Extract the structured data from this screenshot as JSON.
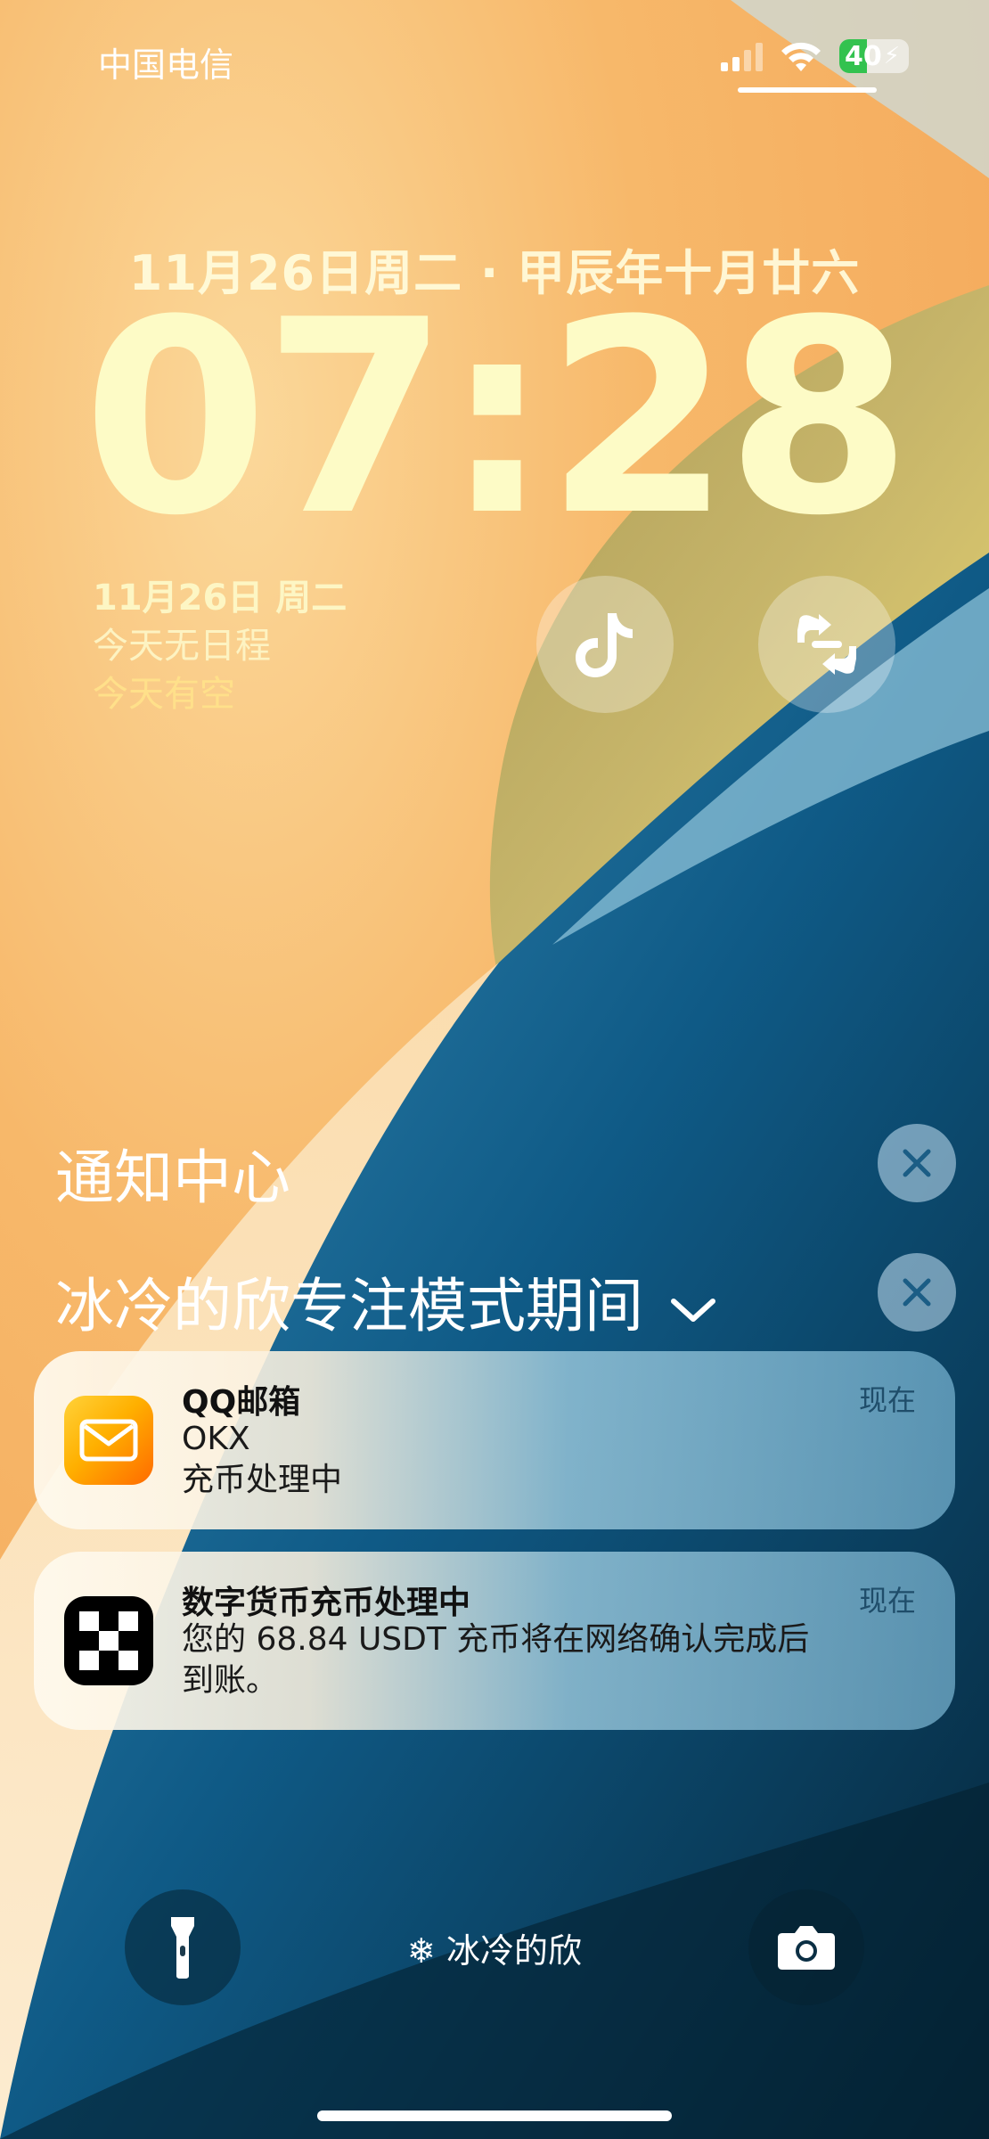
{
  "status_bar": {
    "carrier": "中国电信",
    "battery_level": "40",
    "battery_color": "#33c24f"
  },
  "lock_screen": {
    "date_line": "11月26日周二 · 甲辰年十月廿六",
    "time": "07:28"
  },
  "widget": {
    "date": "11月26日 周二",
    "line1": "今天无日程",
    "line2": "今天有空"
  },
  "shortcuts": {
    "left_icon": "tiktok-icon",
    "right_icon": "transfer-icon"
  },
  "notification_center": {
    "title": "通知中心",
    "focus_title": "冰冷的欣专注模式期间"
  },
  "notifications": [
    {
      "app_icon": "mail-icon",
      "title": "QQ邮箱",
      "line1": "OKX",
      "line2": "充币处理中",
      "time": "现在"
    },
    {
      "app_icon": "okx-logo-icon",
      "title": "数字货币充币处理中",
      "line1": "您的 68.84 USDT 充币将在网络确认完成后",
      "line2": "到账。",
      "time": "现在"
    }
  ],
  "bottom": {
    "focus_label": "❄ 冰冷的欣",
    "left_icon": "flashlight-icon",
    "right_icon": "camera-icon"
  }
}
